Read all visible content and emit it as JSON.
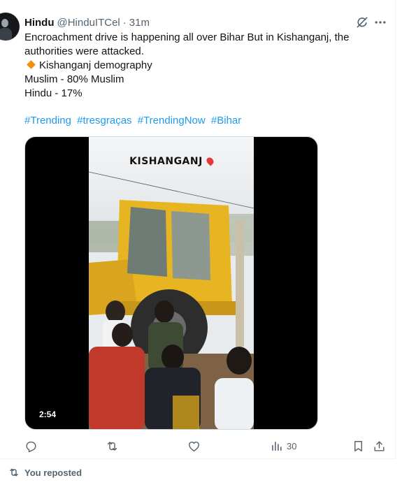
{
  "tweet": {
    "author_name": "Hindu",
    "author_handle": "@HinduITCel",
    "separator": "·",
    "time": "31m",
    "lines": [
      "Encroachment drive is happening all over Bihar  But in Kishanganj, the",
      "authorities were attacked.",
      "Kishanganj demography",
      "Muslim - 80% Muslim",
      "Hindu - 17%"
    ],
    "hashtags": [
      "#Trending",
      "#tresgraças",
      "#TrendingNow",
      "#Bihar"
    ],
    "media": {
      "caption": "KISHANGANJ",
      "duration": "2:54"
    },
    "actions": {
      "views": "30"
    },
    "icons": {
      "grok": "grok-icon",
      "more": "more-icon",
      "reply": "reply-icon",
      "repost": "repost-icon",
      "like": "like-icon",
      "views": "views-icon",
      "bookmark": "bookmark-icon",
      "share": "share-icon"
    }
  },
  "next": {
    "reposted_label": "You reposted"
  },
  "colors": {
    "text": "#0f1419",
    "secondary": "#536471",
    "link": "#1d9bf0",
    "accent_diamond": "#f4900c",
    "machine_yellow": "#e7b522"
  }
}
